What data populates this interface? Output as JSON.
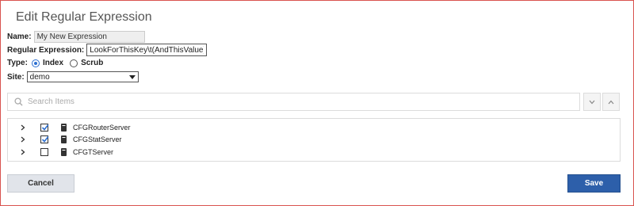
{
  "dialog": {
    "title": "Edit Regular Expression"
  },
  "form": {
    "name_label": "Name:",
    "name_value": "My New Expression",
    "regex_label": "Regular Expression:",
    "regex_value": "LookForThisKey\\t(AndThisValue)",
    "type_label": "Type:",
    "type_options": [
      {
        "label": "Index",
        "selected": true
      },
      {
        "label": "Scrub",
        "selected": false
      }
    ],
    "site_label": "Site:",
    "site_value": "demo"
  },
  "search": {
    "placeholder": "Search Items"
  },
  "tree": {
    "items": [
      {
        "label": "CFGRouterServer",
        "checked": true
      },
      {
        "label": "CFGStatServer",
        "checked": true
      },
      {
        "label": "CFGTServer",
        "checked": false
      }
    ]
  },
  "buttons": {
    "cancel": "Cancel",
    "save": "Save"
  },
  "colors": {
    "accent": "#2d5faa",
    "check": "#2c6fd1",
    "frame": "#d9534f"
  }
}
